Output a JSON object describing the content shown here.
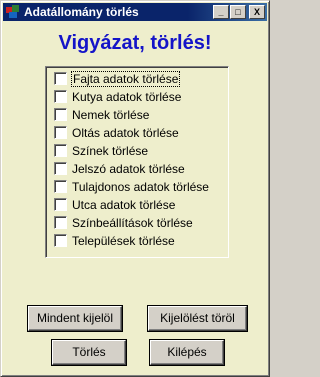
{
  "window": {
    "title": "Adatállomány törlés",
    "controls": {
      "minimize": "_",
      "maximize": "□",
      "close": "X"
    }
  },
  "heading": "Vigyázat, törlés!",
  "checklist": [
    {
      "label": "Fajta adatok törlése",
      "checked": false
    },
    {
      "label": "Kutya adatok törlése",
      "checked": false
    },
    {
      "label": "Nemek törlése",
      "checked": false
    },
    {
      "label": "Oltás adatok törlése",
      "checked": false
    },
    {
      "label": "Színek törlése",
      "checked": false
    },
    {
      "label": "Jelszó adatok törlése",
      "checked": false
    },
    {
      "label": "Tulajdonos adatok törlése",
      "checked": false
    },
    {
      "label": "Utca adatok törlése",
      "checked": false
    },
    {
      "label": "Színbeállítások törlése",
      "checked": false
    },
    {
      "label": "Települések törlése",
      "checked": false
    }
  ],
  "buttons": {
    "select_all": "Mindent kijelöl",
    "clear_selection": "Kijelölést töröl",
    "delete": "Törlés",
    "exit": "Kilépés"
  },
  "colors": {
    "title_bar": "#0a246a",
    "heading": "#1414c8",
    "client_bg": "#eeeecc"
  }
}
